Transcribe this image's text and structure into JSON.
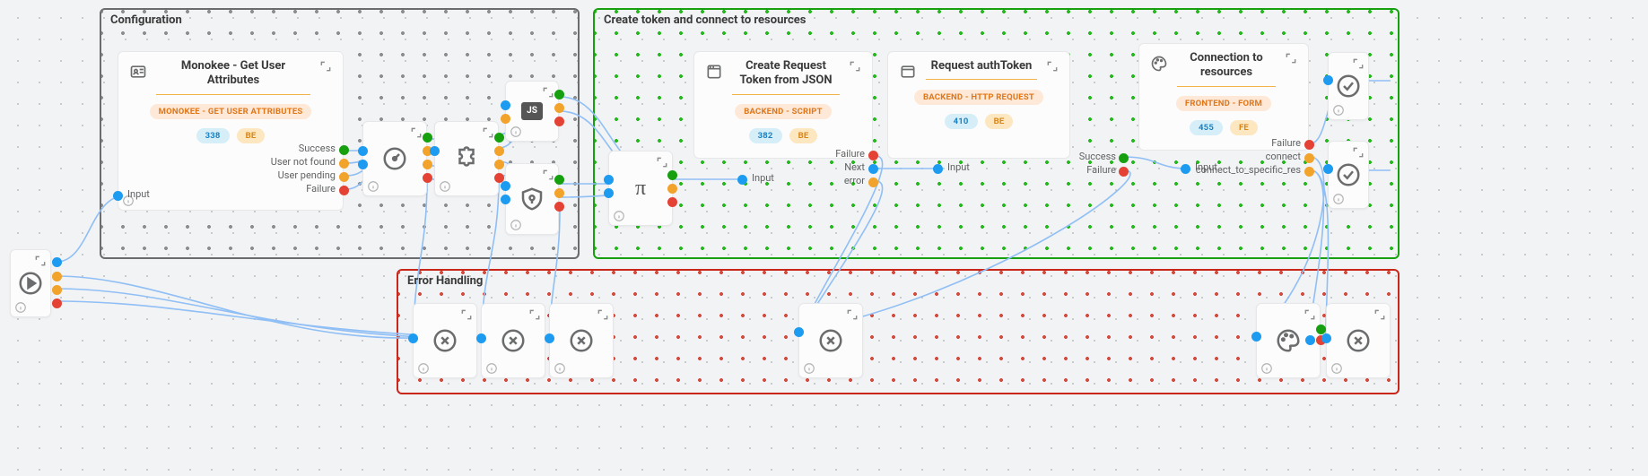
{
  "groups": {
    "configuration": {
      "label": "Configuration"
    },
    "create": {
      "label": "Create token and connect to resources"
    },
    "error": {
      "label": "Error Handling"
    }
  },
  "cards": {
    "monokee": {
      "title": "Monokee - Get User Attributes",
      "tag_main": "MONOKEE - GET USER ATTRIBUTES",
      "tag_id": "338",
      "tag_side": "BE",
      "ports": {
        "input": "Input",
        "success": "Success",
        "user_not_found": "User not found",
        "user_pending": "User pending",
        "failure": "Failure"
      }
    },
    "create_token": {
      "title": "Create Request Token from JSON",
      "tag_main": "BACKEND - SCRIPT",
      "tag_id": "382",
      "tag_side": "BE",
      "ports": {
        "input": "Input",
        "failure": "Failure",
        "next": "Next",
        "error": "error"
      }
    },
    "request_auth": {
      "title": "Request authToken",
      "tag_main": "BACKEND - HTTP REQUEST",
      "tag_id": "410",
      "tag_side": "BE",
      "ports": {
        "input": "Input",
        "success": "Success",
        "failure": "Failure"
      }
    },
    "connection": {
      "title": "Connection to resources",
      "tag_main": "FRONTEND - FORM",
      "tag_id": "455",
      "tag_side": "FE",
      "ports": {
        "input": "Input",
        "failure": "Failure",
        "connect": "connect",
        "connect_specific": "connect_to_specific_res"
      }
    }
  },
  "icons": {
    "start": "play",
    "js": "JS",
    "pi": "π"
  }
}
